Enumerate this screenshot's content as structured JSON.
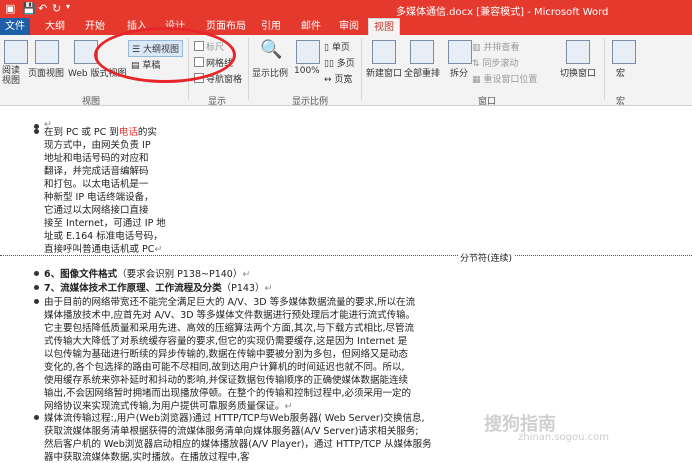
{
  "window": {
    "title": "多媒体通信.docx [兼容模式] - Microsoft Word"
  },
  "tabs": [
    {
      "label": "文件"
    },
    {
      "label": "大纲"
    },
    {
      "label": "开始"
    },
    {
      "label": "插入"
    },
    {
      "label": "设计"
    },
    {
      "label": "页面布局"
    },
    {
      "label": "引用"
    },
    {
      "label": "邮件"
    },
    {
      "label": "审阅"
    },
    {
      "label": "视图"
    }
  ],
  "ribbon": {
    "views": {
      "read": "阅读视图",
      "print": "页面视图",
      "web": "Web 版式视图",
      "outline": "大纲视图",
      "draft": "草稿",
      "group": "视图"
    },
    "show": {
      "ruler": "标尺",
      "grid": "网格线",
      "nav": "导航窗格",
      "group": "显示"
    },
    "zoom": {
      "zoom": "显示比例",
      "pct": "100%",
      "one": "单页",
      "multi": "多页",
      "width": "页宽",
      "group": "显示比例"
    },
    "window": {
      "new": "新建窗口",
      "arrange": "全部重排",
      "split": "拆分",
      "side": "并排查看",
      "sync": "同步滚动",
      "reset": "重设窗口位置",
      "switch": "切换窗口",
      "group": "窗口"
    },
    "macro": {
      "label": "宏",
      "group": "宏"
    }
  },
  "doc": {
    "para1": [
      "在到 PC 或 PC 到",
      "电话",
      "的实",
      "现方式中，由网关负责 IP",
      "地址和电话号码的对应和",
      "翻译，并完成话音编解码",
      "和打包。以太电话机是一",
      "种新型 IP 电话终端设备，",
      "它通过以太网络接口直接",
      "接至 Internet，可通过 IP 地",
      "址或 E.164 标准电话号码，",
      "直接呼叫普通电话机或 PC"
    ],
    "section_break": "分节符(连续)",
    "h6": "6、图像文件格式",
    "h6_note": "（要求会识别 P138~P140）",
    "h7": "7、流媒体技术工作原理、工作流程及分类",
    "h7_note": "（P143）",
    "para2": [
      "由于目前的网络带宽还不能完全满足巨大的 A/V、3D 等多媒体数据流量的要求,所以在流",
      "媒体播放技术中,应首先对 A/V、3D 等多媒体文件数据进行预处理后才能进行流式传输。",
      "它主要包括降低质量和采用先进、高效的压缩算法两个方面,其次,与下载方式相比,尽管流",
      "式传输大大降低了对系统缓存容量的要求,但它的实现仍需要缓存,这是因为 Internet 是",
      "以包传输为基础进行断续的异步传输的,数据在传输中要被分割为多包，但网络又是动态",
      "变化的,各个包选择的路由可能不尽相同,故到达用户计算机的时间延迟也就不同。所以,",
      "使用缓存系统来弥补延时和抖动的影响,并保证数据包传输顺序的正确使媒体数据能连续",
      "输出,不会因网络暂时拥堵而出现播放停顿。在整个的传输和控制过程中,必须采用一定的",
      "网络协议来实现流式传输,为用户提供可靠服务质量保证。"
    ],
    "para3": [
      "媒体流传输过程:,用户(Web浏览器)通过 HTTP/TCP与Web服务器( Web Server)交换信息,",
      "获取流媒体服务清单根据获得的流媒体服务清单向媒体服务器(A/V Server)请求相关服务;",
      "然后客户机的 Web浏览器启动相应的媒体播放器(A/V Player)，通过 HTTP/TCP 从媒体服务",
      "器中获取流媒体数据,实时播放。在播放过程中,客"
    ]
  },
  "watermark": {
    "text": "搜狗指南",
    "sub": "zhinan.sogou.com"
  }
}
